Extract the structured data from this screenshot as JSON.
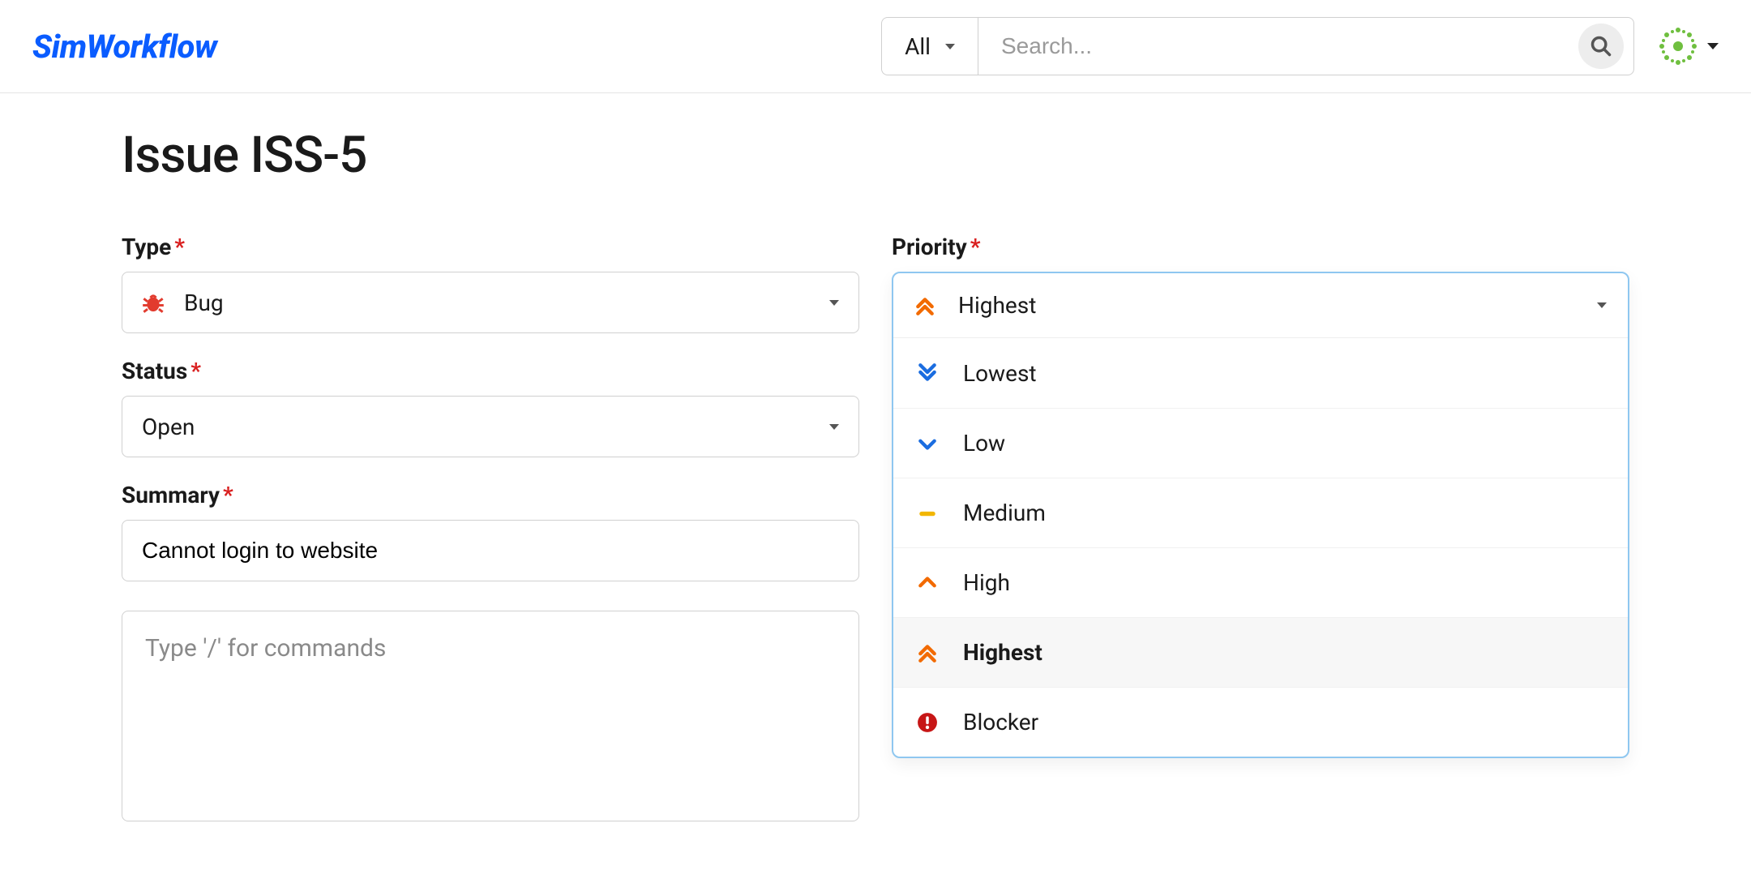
{
  "brand": "SimWorkflow",
  "search": {
    "filter_label": "All",
    "placeholder": "Search..."
  },
  "page": {
    "title": "Issue ISS-5"
  },
  "fields": {
    "type": {
      "label": "Type",
      "value": "Bug"
    },
    "status": {
      "label": "Status",
      "value": "Open"
    },
    "summary": {
      "label": "Summary",
      "value": "Cannot login to website"
    },
    "priority": {
      "label": "Priority",
      "value": "Highest"
    }
  },
  "editor": {
    "placeholder": "Type '/' for commands"
  },
  "priority_options": [
    {
      "label": "Lowest",
      "icon": "double-chevron-down",
      "color": "#1b6de0"
    },
    {
      "label": "Low",
      "icon": "chevron-down",
      "color": "#1b6de0"
    },
    {
      "label": "Medium",
      "icon": "dash",
      "color": "#f2b600"
    },
    {
      "label": "High",
      "icon": "chevron-up",
      "color": "#f26a00"
    },
    {
      "label": "Highest",
      "icon": "double-chevron-up",
      "color": "#f26a00"
    },
    {
      "label": "Blocker",
      "icon": "exclaim-circle",
      "color": "#c71616"
    }
  ],
  "colors": {
    "brand": "#0a5cff",
    "required": "#d92020",
    "focus_border": "#8fc7f0"
  }
}
